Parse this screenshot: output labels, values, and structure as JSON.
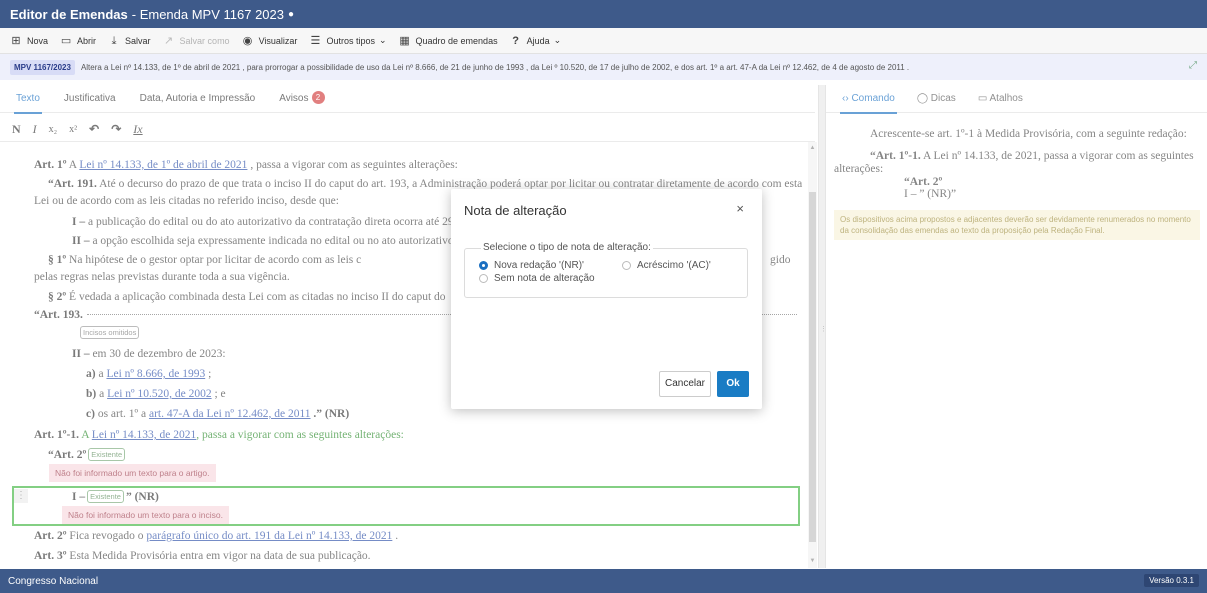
{
  "window": {
    "title_bold": "Editor de Emendas",
    "title_rest": "- Emenda MPV 1167 2023",
    "dirty_marker": "●"
  },
  "toolbar": {
    "items": [
      {
        "label": "Nova",
        "icon": "new-file-icon",
        "glyph": "⊞"
      },
      {
        "label": "Abrir",
        "icon": "folder-icon",
        "glyph": "▭"
      },
      {
        "label": "Salvar",
        "icon": "save-icon",
        "glyph": "⤓"
      },
      {
        "label": "Salvar como",
        "icon": "save-as-icon",
        "glyph": "↗"
      },
      {
        "label": "Visualizar",
        "icon": "eye-icon",
        "glyph": "◉"
      },
      {
        "label": "Outros tipos",
        "icon": "list-icon",
        "glyph": "☰"
      },
      {
        "label": "Quadro de emendas",
        "icon": "table-icon",
        "glyph": "▦"
      },
      {
        "label": "Ajuda",
        "icon": "help-icon",
        "glyph": "?"
      }
    ],
    "chevron": "⌄"
  },
  "mpv": {
    "badge": "MPV 1167/2023",
    "text": "Altera a Lei nº 14.133, de 1º de abril de 2021 , para prorrogar a possibilidade de uso da Lei nº 8.666, de 21 de junho de 1993 , da Lei º 10.520, de 17 de julho de 2002, e dos art. 1º a art. 47-A da Lei nº 12.462, de 4 de agosto de 2011 ."
  },
  "left_tabs": [
    {
      "label": "Texto"
    },
    {
      "label": "Justificativa"
    },
    {
      "label": "Data, Autoria e Impressão"
    },
    {
      "label": "Avisos",
      "badge": "2"
    }
  ],
  "format": {
    "bold": "N",
    "italic": "I",
    "sub": "x₂",
    "sup": "x²",
    "undo": "↶",
    "redo": "↷",
    "clear": "Ix"
  },
  "editor": {
    "l1": {
      "pre": "Art. 1º",
      "a": " A ",
      "link": "Lei nº 14.133, de 1º de abril de 2021",
      "post": " , passa a vigorar com as seguintes alterações:"
    },
    "l2": {
      "pre": "“Art. 191.",
      "post": "  Até o decurso do prazo de que trata o inciso II do caput do art. 193, a Administração poderá optar por licitar ou contratar diretamente de acordo com esta"
    },
    "l3": "Lei ou de acordo com as leis citadas no referido inciso, desde que:",
    "l4": {
      "pre": "I –",
      "post": " a publicação do edital ou do ato autorizativo da contratação direta ocorra até 29"
    },
    "l5": {
      "pre": "II –",
      "post": " a opção escolhida seja expressamente indicada no edital ou no ato autorizativo"
    },
    "l6": {
      "pre": "§ 1º",
      "post": " Na hipótese de o gestor optar por licitar de acordo com as leis c",
      "tail": "gido"
    },
    "l7": "pelas regras nelas previstas durante toda a sua vigência.",
    "l8": {
      "pre": "§ 2º",
      "post": " É vedada a aplicação combinada desta Lei com as citadas no inciso II do caput do"
    },
    "l9": "“Art. 193.",
    "omitted_tag": "Incisos omitidos",
    "l10": {
      "pre": "II –",
      "post": " em 30 de dezembro de 2023:"
    },
    "l11": {
      "pre": "a)",
      "a": " a ",
      "link": "Lei nº 8.666, de 1993",
      "post": " ;"
    },
    "l12": {
      "pre": "b)",
      "a": " a ",
      "link": "Lei nº 10.520, de 2002",
      "post": " ; e"
    },
    "l13": {
      "pre": "c)",
      "a": " os art. 1º a ",
      "link": "art. 47-A da Lei nº 12.462, de 2011",
      "post": " .” (NR)"
    },
    "l14": {
      "pre": "Art. 1º-1.",
      "a": " A ",
      "link": "Lei nº 14.133, de 2021",
      "post": ", passa a vigorar com as seguintes alterações:"
    },
    "l15": {
      "pre": "“Art. 2º",
      "tag": "Existente"
    },
    "err1": "Não foi informado um texto para o artigo.",
    "l16": {
      "pre": "I –",
      "tag": "Existente",
      "post": "” (NR)"
    },
    "err2": "Não foi informado um texto para o inciso.",
    "l17": {
      "pre": "Art. 2º",
      "a": " Fica revogado o ",
      "link": "parágrafo único do art. 191 da Lei nº 14.133, de 2021",
      "post": " ."
    },
    "l18": {
      "pre": "Art. 3º",
      "post": " Esta Medida Provisória entra em vigor na data de sua publicação."
    },
    "handle": "⋮"
  },
  "right_tabs": [
    {
      "label": "Comando",
      "glyph": "‹›"
    },
    {
      "label": "Dicas",
      "glyph": "◯"
    },
    {
      "label": "Atalhos",
      "glyph": "▭"
    }
  ],
  "command": {
    "p1": "Acrescente-se art. 1º-1 à Medida Provisória, com a seguinte redação:",
    "p2_bold": "“Art. 1º-1.",
    "p2_rest": " A Lei nº 14.133, de 2021, passa a vigorar com as seguintes alterações:",
    "p3": "“Art. 2º",
    "p4": "I – ” (NR)”",
    "warn": "Os dispositivos acima propostos e adjacentes deverão ser devidamente renumerados no momento da consolidação das emendas ao texto da proposição pela Redação Final."
  },
  "modal": {
    "title": "Nota de alteração",
    "close": "×",
    "legend": "Selecione o tipo de nota de alteração:",
    "options": [
      {
        "label": "Nova redação '(NR)'",
        "selected": true
      },
      {
        "label": "Acréscimo '(AC)'",
        "selected": false
      },
      {
        "label": "Sem nota de alteração",
        "selected": false
      }
    ],
    "cancel": "Cancelar",
    "ok": "Ok"
  },
  "status": {
    "left": "Congresso Nacional",
    "version": "Versão 0.3.1"
  },
  "colors": {
    "header": "#3e5a8a",
    "accent": "#1a6fc1",
    "error_bg": "#f7d8de",
    "selected_border": "#41b541"
  }
}
